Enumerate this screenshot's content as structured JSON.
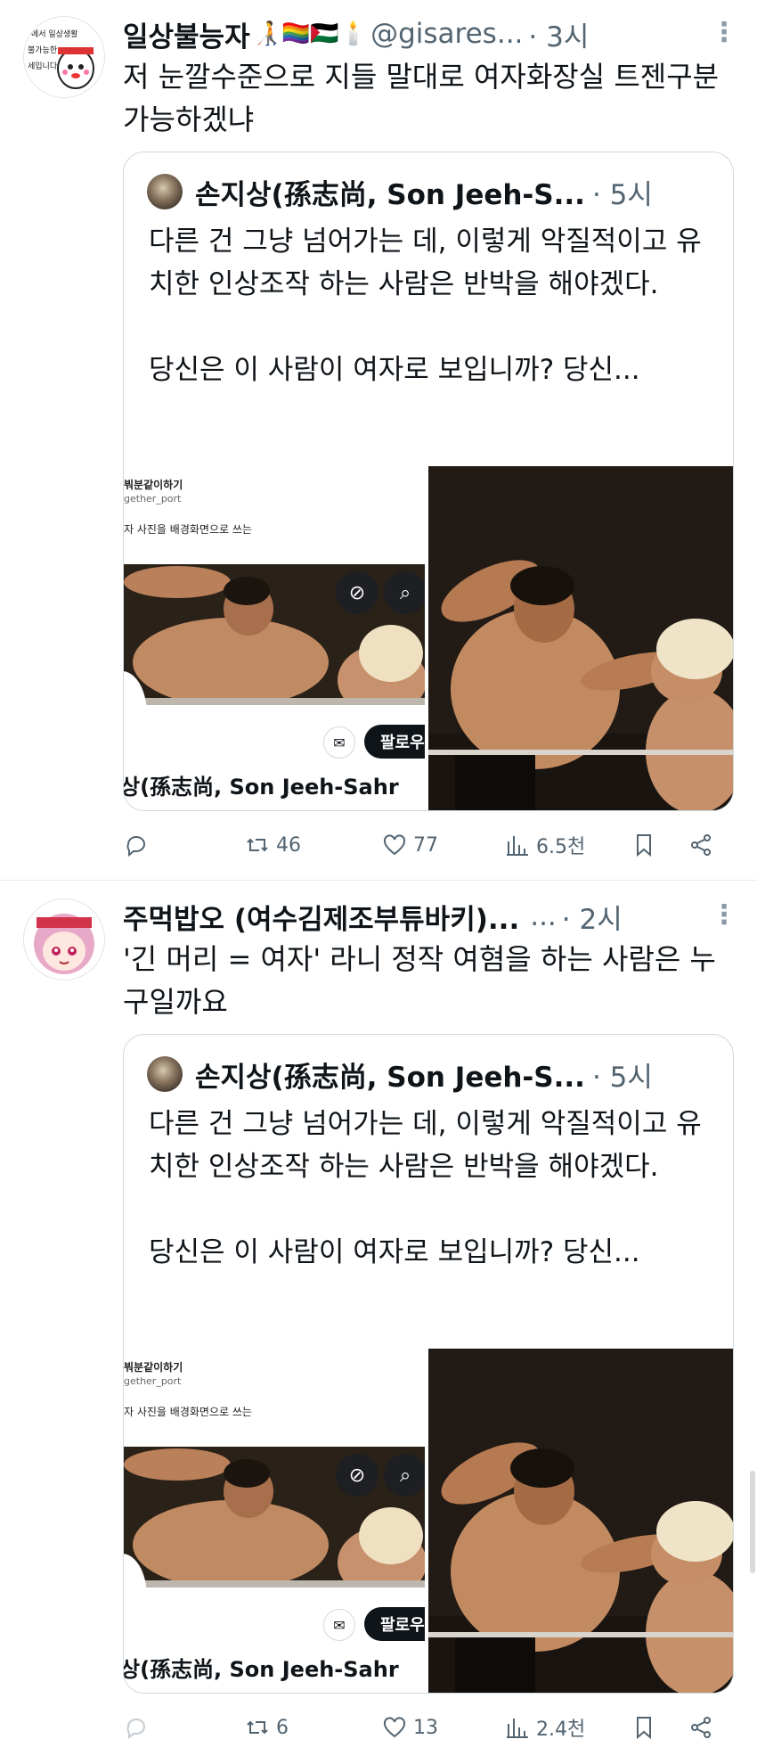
{
  "tweets": [
    {
      "name": "일상불능자",
      "emoji": "🧑‍🦯🏳️‍🌈🇵🇸🕯️",
      "handle": "@gisares...",
      "time": "· 3시",
      "text": "저 눈깔수준으로 지들 말대로 여자화장실 트젠구분 가능하겠냐",
      "avatar_text": "에서 일상생활 불가능한 세입니다",
      "quote": {
        "name": "손지상(孫志尚, Son Jeeh-S...",
        "time": "· 5시",
        "text": "다른 건 그냥 넘어가는 데, 이렇게 악질적이고 유치한 인상조작 하는 사람은 반박을 해야겠다.\n\n당신은 이 사람이 여자로 보입니까? 당신...",
        "media_title": "붜분같이하기",
        "media_handle": "gether_port",
        "media_caption": "자 사진을 배경화면으로 쓰는",
        "follow": "팔로우",
        "media_name": "상(孫志尚, Son Jeeh-Sahr"
      },
      "stats": {
        "retweets": "46",
        "likes": "77",
        "views": "6.5천"
      }
    },
    {
      "name": "주먹밥오 (여수김제조부튜바키)...",
      "emoji": "",
      "handle": "...",
      "time": "· 2시",
      "text": "'긴 머리 = 여자' 라니 정작 여혐을 하는 사람은 누구일까요",
      "avatar_text": "",
      "quote": {
        "name": "손지상(孫志尚, Son Jeeh-S...",
        "time": "· 5시",
        "text": "다른 건 그냥 넘어가는 데, 이렇게 악질적이고 유치한 인상조작 하는 사람은 반박을 해야겠다.\n\n당신은 이 사람이 여자로 보입니까? 당신...",
        "media_title": "붜분같이하기",
        "media_handle": "gether_port",
        "media_caption": "자 사진을 배경화면으로 쓰는",
        "follow": "팔로우",
        "media_name": "상(孫志尚, Son Jeeh-Sahr"
      },
      "stats": {
        "retweets": "6",
        "likes": "13",
        "views": "2.4천"
      }
    }
  ],
  "icons": [
    "reply-icon",
    "retweet-icon",
    "like-icon",
    "views-icon",
    "bookmark-icon",
    "share-icon",
    "more-icon",
    "mute-icon",
    "search-icon",
    "mail-icon"
  ]
}
